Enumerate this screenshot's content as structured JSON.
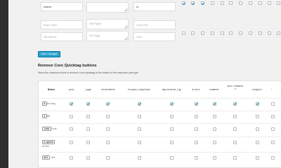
{
  "top_fields": {
    "row1": [
      "amazon",
      "",
      "rq"
    ],
    "row2_placeholders": [
      "Button Label*",
      "Start Tag(s)*",
      "Access Key"
    ],
    "row3_placeholders": [
      "Title Attribute",
      "End Tag(s)",
      "Order"
    ]
  },
  "top_checkboxes": {
    "row1": [
      true,
      true,
      true,
      false,
      false,
      false,
      false,
      false,
      false,
      false,
      false
    ],
    "row2": [
      false,
      false,
      false,
      false,
      false,
      false,
      false,
      false,
      false,
      false,
      false
    ]
  },
  "save_button_label": "Save Changes",
  "section_title": "Remove Core Quicktag buttons",
  "section_description": "Select the checkbox below to remove a core quicktags in the editors of the respective post type.",
  "table": {
    "columns": [
      "Button",
      "post",
      "page",
      "attachment",
      "tinywoo-templates",
      "deprecated_log",
      "archiv",
      "comment",
      "edit-comments",
      "widgets",
      "✓"
    ],
    "rows": [
      {
        "key": "b",
        "tag": "strong",
        "checks": [
          true,
          true,
          true,
          true,
          true,
          true,
          true,
          true,
          true,
          false
        ]
      },
      {
        "key": "i",
        "tag": "em",
        "checks": [
          false,
          false,
          false,
          false,
          false,
          false,
          false,
          false,
          false,
          false
        ]
      },
      {
        "key": "link",
        "tag": "link",
        "checks": [
          false,
          false,
          false,
          false,
          false,
          false,
          false,
          false,
          false,
          false
        ]
      },
      {
        "key": "b-quote",
        "tag": "block",
        "checks": [
          false,
          false,
          false,
          false,
          false,
          false,
          false,
          false,
          false,
          false
        ]
      },
      {
        "key": "del",
        "tag": "del",
        "checks": [
          false,
          false,
          false,
          false,
          false,
          false,
          false,
          false,
          false,
          false
        ]
      }
    ]
  }
}
